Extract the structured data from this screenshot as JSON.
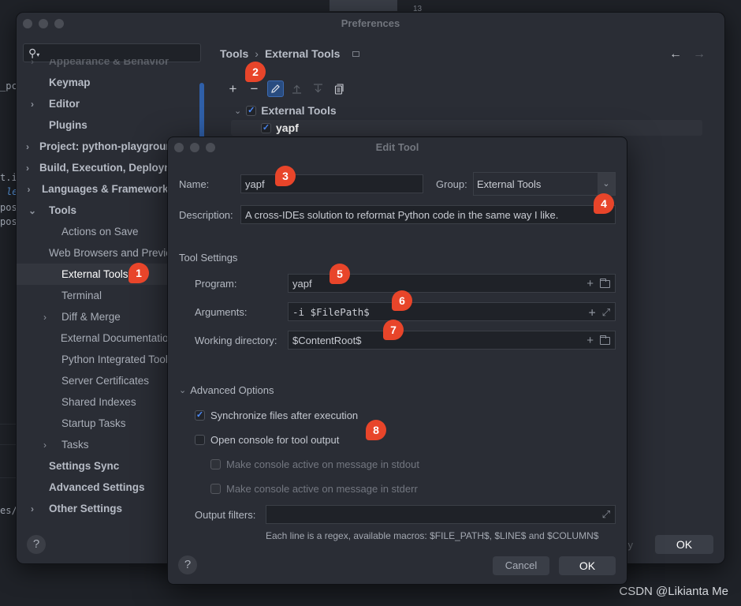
{
  "background": {
    "code_fragments": [
      "_pc",
      "t.i",
      "le",
      "pos",
      "pos",
      "es/"
    ],
    "line_number": "13",
    "watermark": "CSDN @Likianta Me"
  },
  "preferences": {
    "title": "Preferences",
    "search": {
      "icon": "search-icon",
      "value": "",
      "placeholder": ""
    },
    "sidebar": {
      "items": [
        {
          "label": "Appearance & Behavior",
          "expandable": true,
          "level": 0
        },
        {
          "label": "Keymap",
          "expandable": false,
          "level": 0
        },
        {
          "label": "Editor",
          "expandable": true,
          "level": 0
        },
        {
          "label": "Plugins",
          "expandable": false,
          "level": 0
        },
        {
          "label": "Project: python-playground",
          "expandable": true,
          "level": 0
        },
        {
          "label": "Build, Execution, Deployment",
          "expandable": true,
          "level": 0
        },
        {
          "label": "Languages & Frameworks",
          "expandable": true,
          "level": 0
        },
        {
          "label": "Tools",
          "expandable": true,
          "expanded": true,
          "level": 0
        },
        {
          "label": "Actions on Save",
          "level": 1
        },
        {
          "label": "Web Browsers and Preview",
          "level": 1
        },
        {
          "label": "External Tools",
          "level": 1,
          "selected": true
        },
        {
          "label": "Terminal",
          "level": 1
        },
        {
          "label": "Diff & Merge",
          "expandable": true,
          "level": 1
        },
        {
          "label": "External Documentation",
          "level": 1
        },
        {
          "label": "Python Integrated Tools",
          "level": 1
        },
        {
          "label": "Server Certificates",
          "level": 1
        },
        {
          "label": "Shared Indexes",
          "level": 1
        },
        {
          "label": "Startup Tasks",
          "level": 1
        },
        {
          "label": "Tasks",
          "expandable": true,
          "level": 1
        },
        {
          "label": "Settings Sync",
          "level": 0
        },
        {
          "label": "Advanced Settings",
          "level": 0
        },
        {
          "label": "Other Settings",
          "expandable": true,
          "level": 0
        }
      ]
    },
    "breadcrumb": {
      "parent": "Tools",
      "separator": "›",
      "current": "External Tools"
    },
    "nav": {
      "back": "←",
      "forward": "→"
    },
    "toolbar": {
      "add": "+",
      "remove": "−",
      "edit": "edit-icon",
      "move_up": "move-up-icon",
      "move_down": "move-down-icon",
      "copy": "copy-icon"
    },
    "tree": {
      "group": {
        "label": "External Tools",
        "checked": true,
        "expanded": true
      },
      "items": [
        {
          "label": "yapf",
          "checked": true,
          "selected": true
        }
      ]
    },
    "help": "?",
    "ok_label": "OK",
    "ghost_text": "y"
  },
  "edit_tool": {
    "title": "Edit Tool",
    "name_label": "Name:",
    "name_value": "yapf",
    "group_label": "Group:",
    "group_value": "External Tools",
    "description_label": "Description:",
    "description_value": "A cross-IDEs solution to reformat Python code in the same way I like.",
    "tool_settings_title": "Tool Settings",
    "program_label": "Program:",
    "program_value": "yapf",
    "arguments_label": "Arguments:",
    "arguments_value": "-i $FilePath$",
    "working_dir_label": "Working directory:",
    "working_dir_value": "$ContentRoot$",
    "advanced_title": "Advanced Options",
    "options": [
      {
        "label": "Synchronize files after execution",
        "checked": true,
        "enabled": true
      },
      {
        "label": "Open console for tool output",
        "checked": false,
        "enabled": true
      },
      {
        "label": "Make console active on message in stdout",
        "checked": false,
        "enabled": false
      },
      {
        "label": "Make console active on message in stderr",
        "checked": false,
        "enabled": false
      }
    ],
    "output_filters_label": "Output filters:",
    "output_filters_value": "",
    "hint": "Each line is a regex, available macros: $FILE_PATH$, $LINE$ and $COLUMN$",
    "help": "?",
    "cancel_label": "Cancel",
    "ok_label": "OK"
  },
  "annotations": [
    "1",
    "2",
    "3",
    "4",
    "5",
    "6",
    "7",
    "8"
  ],
  "colors": {
    "accent": "#2f5fa8",
    "checkmark": "#4d8dff",
    "marker": "#e8452a",
    "background": "#2a2d35"
  }
}
